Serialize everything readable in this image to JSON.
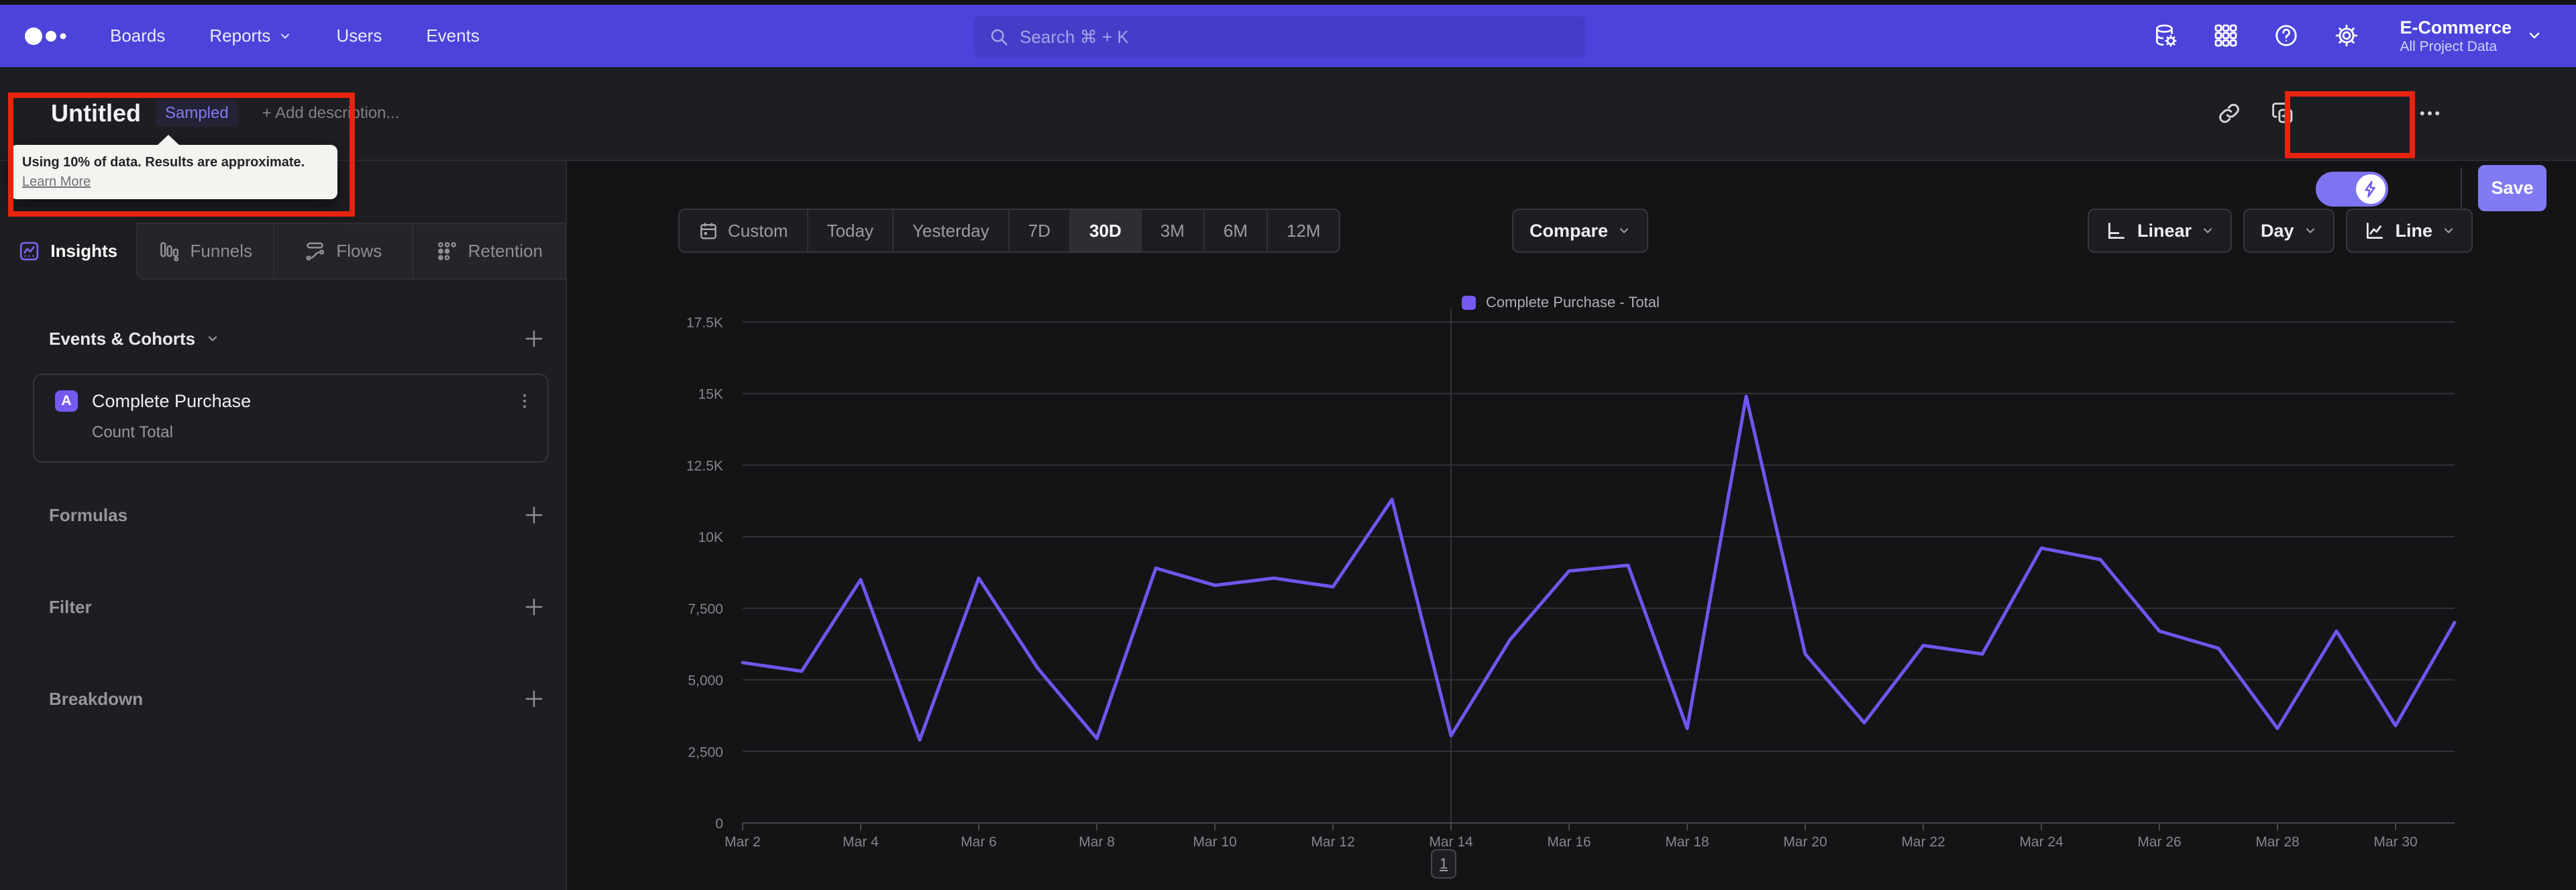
{
  "nav": {
    "items": [
      "Boards",
      "Reports",
      "Users",
      "Events"
    ],
    "search_placeholder": "Search  ⌘ + K",
    "project_name": "E-Commerce",
    "project_scope": "All Project Data"
  },
  "header": {
    "title": "Untitled",
    "badge": "Sampled",
    "add_description": "+ Add description...",
    "save_label": "Save",
    "tooltip_message": "Using 10% of data. Results are approximate.",
    "tooltip_link": "Learn More"
  },
  "sidebar": {
    "tabs": [
      {
        "label": "Insights",
        "active": true
      },
      {
        "label": "Funnels",
        "active": false
      },
      {
        "label": "Flows",
        "active": false
      },
      {
        "label": "Retention",
        "active": false
      }
    ],
    "events_header": "Events & Cohorts",
    "event": {
      "letter": "A",
      "name": "Complete Purchase",
      "metric": "Count Total"
    },
    "sections": [
      "Formulas",
      "Filter",
      "Breakdown"
    ]
  },
  "toolbar": {
    "ranges": [
      "Custom",
      "Today",
      "Yesterday",
      "7D",
      "30D",
      "3M",
      "6M",
      "12M"
    ],
    "active_range": "30D",
    "compare_label": "Compare",
    "scale_label": "Linear",
    "granularity_label": "Day",
    "chart_type_label": "Line"
  },
  "pagination_label": "1",
  "colors": {
    "nav_accent": "#4b43da",
    "series_purple": "#6f56ee",
    "save_button": "#827af3",
    "annotation_red": "#e8240f",
    "grid_line": "#323338",
    "axis_line": "#46474c",
    "axis_text": "#85868b"
  },
  "chart_data": {
    "type": "line",
    "legend": [
      "Complete Purchase - Total"
    ],
    "legend_position": "top-center",
    "grid": true,
    "x": [
      "Mar 2",
      "Mar 3",
      "Mar 4",
      "Mar 5",
      "Mar 6",
      "Mar 7",
      "Mar 8",
      "Mar 9",
      "Mar 10",
      "Mar 11",
      "Mar 12",
      "Mar 13",
      "Mar 14",
      "Mar 15",
      "Mar 16",
      "Mar 17",
      "Mar 18",
      "Mar 19",
      "Mar 20",
      "Mar 21",
      "Mar 22",
      "Mar 23",
      "Mar 24",
      "Mar 25",
      "Mar 26",
      "Mar 27",
      "Mar 28",
      "Mar 29",
      "Mar 30",
      "Mar 31"
    ],
    "series": [
      {
        "name": "Complete Purchase - Total",
        "color": "#6f56ee",
        "values": [
          5600,
          5300,
          8500,
          2900,
          8550,
          5400,
          2950,
          8900,
          8300,
          8550,
          8250,
          11300,
          3050,
          6400,
          8800,
          9000,
          3300,
          14900,
          5900,
          3500,
          6200,
          5900,
          9600,
          9200,
          6700,
          6100,
          3300,
          6700,
          3400,
          7000
        ]
      }
    ],
    "ylim": [
      0,
      17500
    ],
    "yticks": [
      {
        "v": 0,
        "label": "0"
      },
      {
        "v": 2500,
        "label": "2,500"
      },
      {
        "v": 5000,
        "label": "5,000"
      },
      {
        "v": 7500,
        "label": "7,500"
      },
      {
        "v": 10000,
        "label": "10K"
      },
      {
        "v": 12500,
        "label": "12.5K"
      },
      {
        "v": 15000,
        "label": "15K"
      },
      {
        "v": 17500,
        "label": "17.5K"
      }
    ],
    "xtick_every": 2,
    "x_gridline_at": "Mar 14",
    "xlabel": "",
    "ylabel": ""
  }
}
